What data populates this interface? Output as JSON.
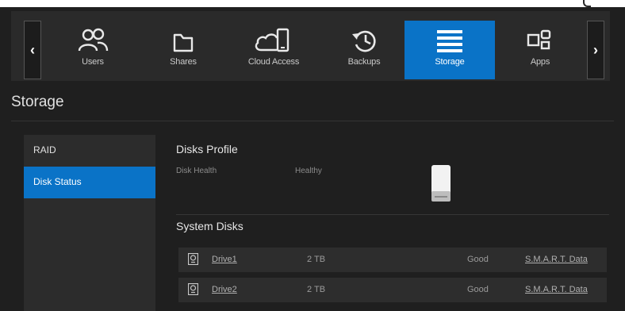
{
  "nav": {
    "items": [
      {
        "label": "Users",
        "icon": "users-icon"
      },
      {
        "label": "Shares",
        "icon": "folder-icon"
      },
      {
        "label": "Cloud Access",
        "icon": "cloud-device-icon"
      },
      {
        "label": "Backups",
        "icon": "history-icon"
      },
      {
        "label": "Storage",
        "icon": "storage-icon",
        "active": true
      },
      {
        "label": "Apps",
        "icon": "apps-icon"
      }
    ],
    "prev_arrow": "‹",
    "next_arrow": "›"
  },
  "page": {
    "title": "Storage"
  },
  "sidebar": {
    "items": [
      {
        "label": "RAID"
      },
      {
        "label": "Disk Status",
        "active": true
      }
    ]
  },
  "disks_profile": {
    "heading": "Disks Profile",
    "health_label": "Disk Health",
    "health_value": "Healthy"
  },
  "system_disks": {
    "heading": "System Disks",
    "rows": [
      {
        "name": "Drive1",
        "size": "2 TB",
        "status": "Good",
        "link": "S.M.A.R.T. Data"
      },
      {
        "name": "Drive2",
        "size": "2 TB",
        "status": "Good",
        "link": "S.M.A.R.T. Data"
      }
    ]
  },
  "colors": {
    "accent": "#0a73c7",
    "background": "#1f1f1f",
    "panel": "#2a2a2a"
  }
}
